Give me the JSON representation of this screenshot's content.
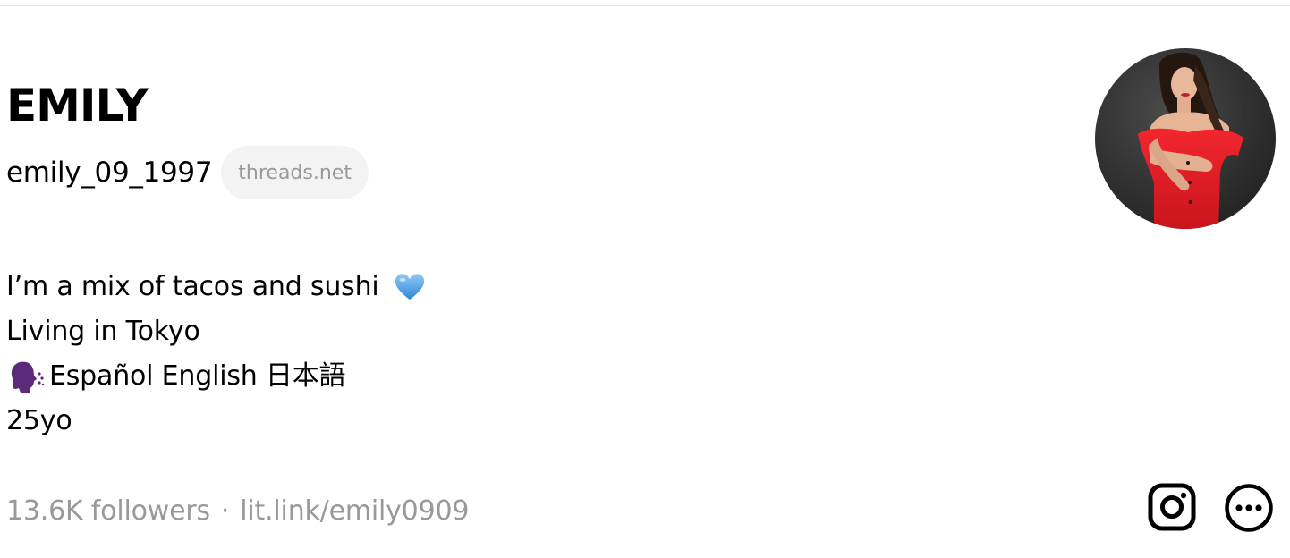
{
  "profile": {
    "display_name": "EMILY",
    "handle": "emily_09_1997",
    "domain_badge": "threads.net",
    "bio": {
      "line1": "I’m a mix of tacos and sushi",
      "line1_icon": "blue-heart-icon",
      "line2": "Living in Tokyo",
      "line3_icon": "speaking-head-icon",
      "line3": "Español English 日本語",
      "line4": "25yo"
    },
    "followers": "13.6K followers",
    "separator": "·",
    "link": "lit.link/emily0909",
    "avatar_icon": "profile-avatar"
  },
  "actions": {
    "instagram_icon": "instagram-icon",
    "more_icon": "more-options-icon"
  },
  "colors": {
    "text": "#000000",
    "muted": "#999999",
    "badge_bg": "#f3f3f3",
    "heart": "#5aa9e6",
    "avatar_dress": "#e8202a"
  }
}
